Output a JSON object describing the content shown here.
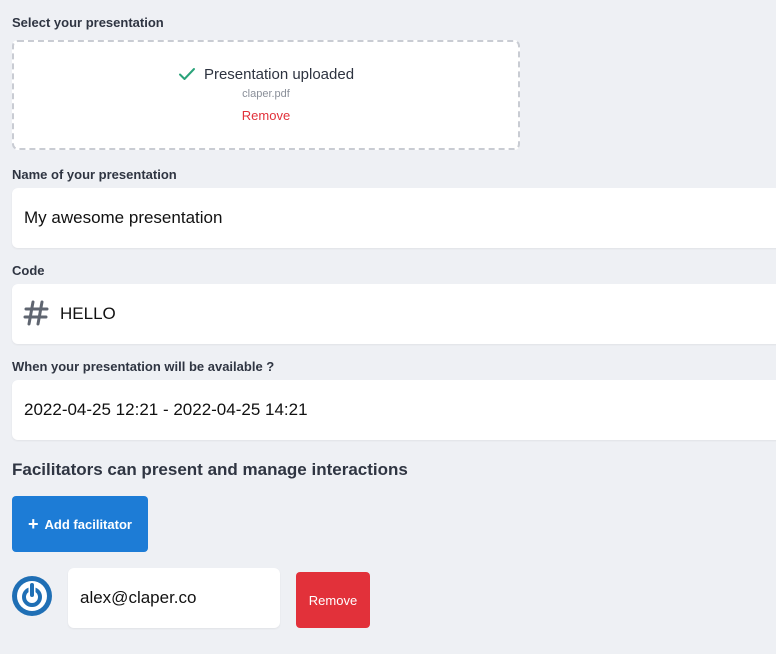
{
  "upload": {
    "label": "Select your presentation",
    "status": "Presentation uploaded",
    "filename": "claper.pdf",
    "remove_label": "Remove",
    "status_icon": "check-icon"
  },
  "name_field": {
    "label": "Name of your presentation",
    "value": "My awesome presentation"
  },
  "code_field": {
    "label": "Code",
    "icon": "hash-icon",
    "value": "HELLO"
  },
  "availability_field": {
    "label": "When your presentation will be available ?",
    "value": "2022-04-25 12:21 - 2022-04-25 14:21"
  },
  "facilitators": {
    "title": "Facilitators can present and manage interactions",
    "add_button_label": "Add facilitator",
    "items": [
      {
        "email": "alex@claper.co",
        "remove_label": "Remove",
        "avatar_icon": "power-avatar-icon"
      }
    ]
  },
  "colors": {
    "primary": "#1d7cd6",
    "danger": "#e2313a",
    "success": "#2aa37a",
    "background": "#eef0f4"
  }
}
